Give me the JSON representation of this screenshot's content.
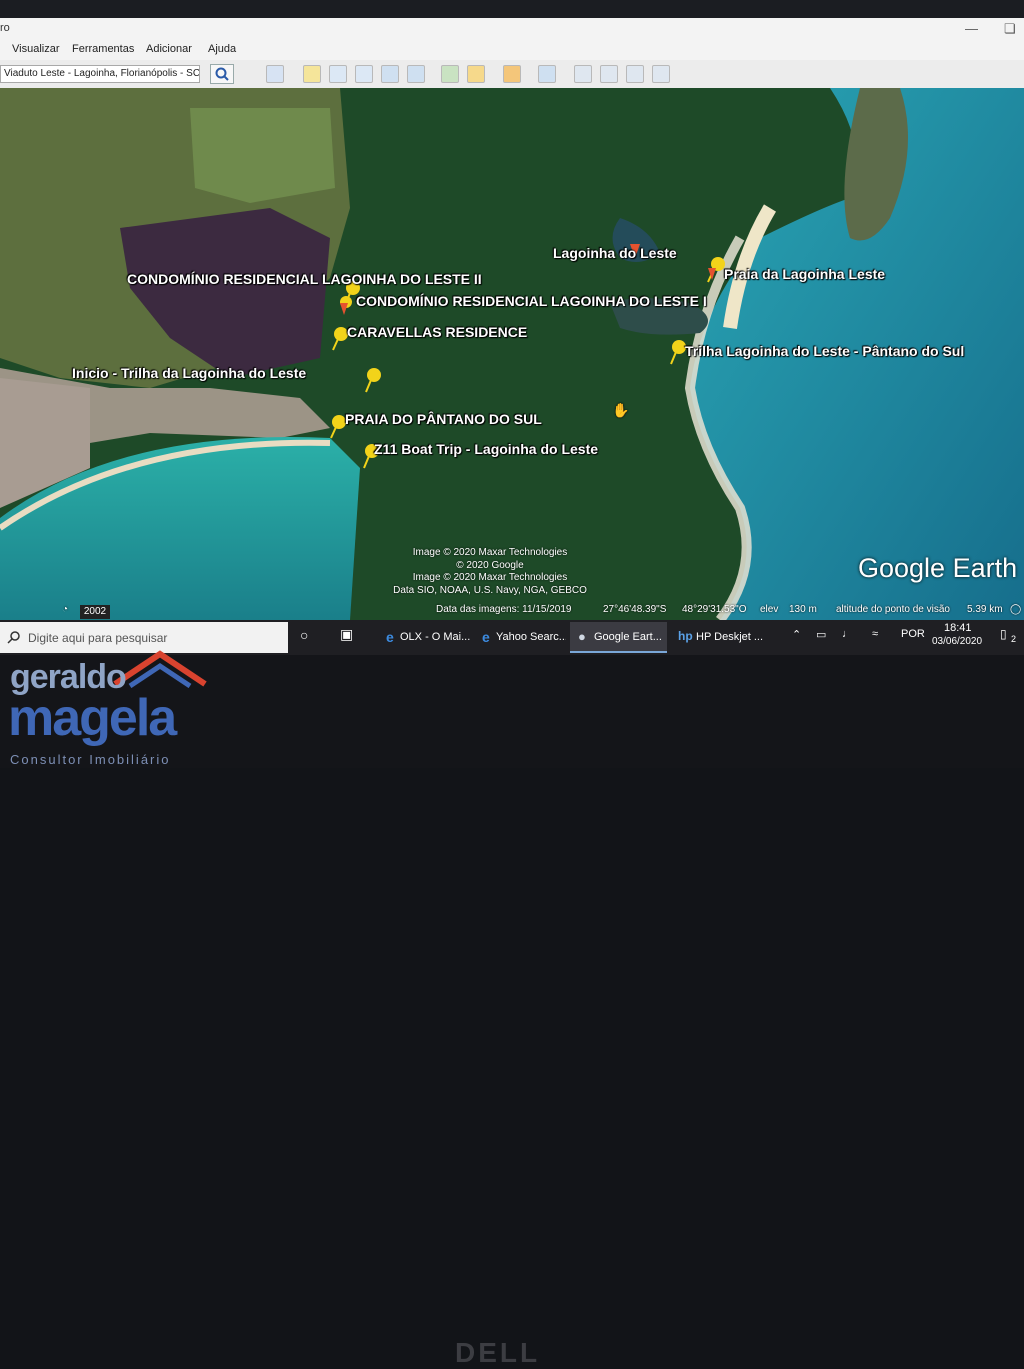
{
  "window": {
    "title_fragment": "ro"
  },
  "menu": [
    "Visualizar",
    "Ferramentas",
    "Adicionar",
    "Ajuda"
  ],
  "search": {
    "value": "Viaduto Leste - Lagoinha, Florianópolis - SC"
  },
  "placemarks": [
    {
      "label": "Lagoinha do Leste"
    },
    {
      "label": "Praia da Lagoinha Leste"
    },
    {
      "label": "CONDOMÍNIO RESIDENCIAL LAGOINHA DO LESTE II"
    },
    {
      "label": "CONDOMÍNIO RESIDENCIAL LAGOINHA DO LESTE I"
    },
    {
      "label": "CARAVELLAS RESIDENCE"
    },
    {
      "label": "Trilha Lagoinha do Leste - Pântano do Sul"
    },
    {
      "label": "Inicio - Trilha da Lagoinha do Leste"
    },
    {
      "label": "PRAIA DO PÂNTANO DO SUL"
    },
    {
      "label": "Z11 Boat Trip - Lagoinha do Leste"
    }
  ],
  "credits": [
    "Image © 2020 Maxar Technologies",
    "© 2020 Google",
    "Image © 2020 Maxar Technologies",
    "Data SIO, NOAA, U.S. Navy, NGA, GEBCO"
  ],
  "brand": "Google Earth",
  "status": {
    "history_year": "2002",
    "imagery_date": "Data das imagens: 11/15/2019",
    "lat": "27°46'48.39\"S",
    "lon": "48°29'31.53\"O",
    "elev_label": "elev",
    "elev_value": "130 m",
    "eye_alt_label": "altitude do ponto de visão",
    "eye_alt_value": "5.39 km"
  },
  "taskbar": {
    "search_placeholder": "Digite aqui para pesquisar",
    "apps": [
      {
        "label": "OLX - O Mai..."
      },
      {
        "label": "Yahoo Searc..."
      },
      {
        "label": "Google Eart..."
      },
      {
        "label": "HP Deskjet ..."
      }
    ],
    "language": "POR",
    "time": "18:41",
    "date": "03/06/2020",
    "notifications": "2"
  },
  "bezel": {
    "brand": "DELL"
  },
  "watermark": {
    "line1": "geraldo",
    "line2": "magela",
    "line3": "Consultor Imobiliário"
  },
  "colors": {
    "ocean": "#1f8fa4",
    "forest": "#1f4d2a",
    "pin": "#f2d31a",
    "accent": "#3f67b6"
  }
}
